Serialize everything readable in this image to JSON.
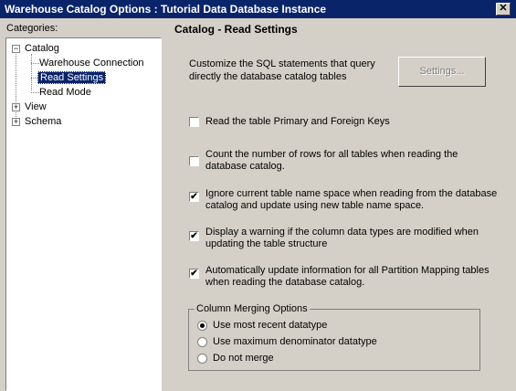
{
  "window": {
    "title": "Warehouse Catalog Options : Tutorial Data Database Instance",
    "close_glyph": "✕"
  },
  "categories_label": "Categories:",
  "tree": {
    "catalog": {
      "label": "Catalog",
      "expander": "−"
    },
    "children": [
      "Warehouse Connection",
      "Read Settings",
      "Read Mode"
    ],
    "view": {
      "label": "View",
      "expander": "+"
    },
    "schema": {
      "label": "Schema",
      "expander": "+"
    }
  },
  "panel": {
    "heading": "Catalog - Read Settings",
    "description": "Customize the SQL statements that query directly the database catalog tables",
    "settings_button": "Settings...",
    "checkboxes": [
      {
        "label": "Read the table Primary and Foreign Keys",
        "checked": false
      },
      {
        "label": "Count the number of rows for all tables when reading the database catalog.",
        "checked": false
      },
      {
        "label": "Ignore current table name space when reading from the database catalog and update using new table name space.",
        "checked": true
      },
      {
        "label": "Display a warning if the column data types are modified when updating the table structure",
        "checked": true
      },
      {
        "label": "Automatically update information for all Partition Mapping tables when reading the database catalog.",
        "checked": true
      }
    ],
    "check_glyph": "✔",
    "group": {
      "title": "Column Merging Options",
      "options": [
        {
          "label": "Use most recent datatype",
          "selected": true
        },
        {
          "label": "Use maximum denominator datatype",
          "selected": false
        },
        {
          "label": "Do not merge",
          "selected": false
        }
      ]
    }
  }
}
